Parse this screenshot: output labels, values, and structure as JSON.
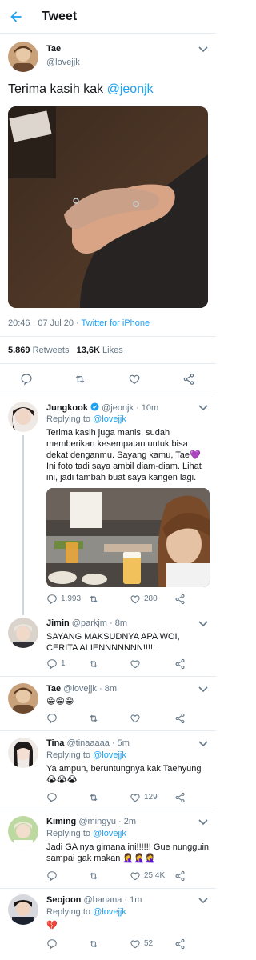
{
  "header": {
    "title": "Tweet"
  },
  "main_tweet": {
    "name": "Tae",
    "handle": "@lovejjk",
    "text_prefix": "Terima kasih kak ",
    "text_mention": "@jeonjk",
    "time": "20:46 · 07 Jul 20 · ",
    "client": "Twitter for iPhone",
    "retweets": "5.869",
    "retweets_label": " Retweets",
    "likes": "13,6K",
    "likes_label": " Likes"
  },
  "replies": [
    {
      "name": "Jungkook",
      "handle": "@jeonjk",
      "time": "10m",
      "replying_prefix": "Replying to ",
      "replying_to": "@lovejjk",
      "text": "Terima kasih juga manis, sudah memberikan kesempatan untuk bisa dekat denganmu. Sayang kamu, Tae💜 Ini foto tadi saya ambil diam-diam. Lihat ini, jadi tambah buat saya kangen lagi.",
      "replies": "1.993",
      "retweets": "",
      "likes": "280"
    },
    {
      "name": "Jimin",
      "handle": "@parkjm",
      "time": "8m",
      "text": "SAYANG MAKSUDNYA APA WOI, CERITA ALIENNNNNNN!!!!!",
      "replies": "1",
      "retweets": "",
      "likes": ""
    },
    {
      "name": "Tae",
      "handle": "@lovejjk",
      "time": "8m",
      "text": "😁😁😁",
      "replies": "",
      "retweets": "",
      "likes": ""
    },
    {
      "name": "Tina",
      "handle": "@tinaaaaa",
      "time": "5m",
      "replying_prefix": "Replying to ",
      "replying_to": "@lovejjk",
      "text": "Ya ampun, beruntungnya kak Taehyung 😭😭😭",
      "replies": "",
      "retweets": "",
      "likes": "129"
    },
    {
      "name": "Kiming",
      "handle": "@mingyu",
      "time": "2m",
      "replying_prefix": "Replying to ",
      "replying_to": "@lovejjk",
      "text": "Jadi GA nya gimana ini!!!!!! Gue nungguin sampai gak makan 🤦‍♀️🤦‍♀️🤦‍♀️",
      "replies": "",
      "retweets": "",
      "likes": "25,4K"
    },
    {
      "name": "Seojoon",
      "handle": "@banana",
      "time": "1m",
      "replying_prefix": "Replying to ",
      "replying_to": "@lovejjk",
      "text": "💔",
      "replies": "",
      "retweets": "",
      "likes": "52"
    }
  ],
  "colors": {
    "accent": "#1da1f2",
    "muted": "#657786",
    "divider": "#e6ecf0",
    "verified": "#1da1f2"
  },
  "icons": [
    "back-arrow-icon",
    "chevron-down-icon",
    "reply-icon",
    "retweet-icon",
    "like-icon",
    "share-icon",
    "verified-icon"
  ]
}
